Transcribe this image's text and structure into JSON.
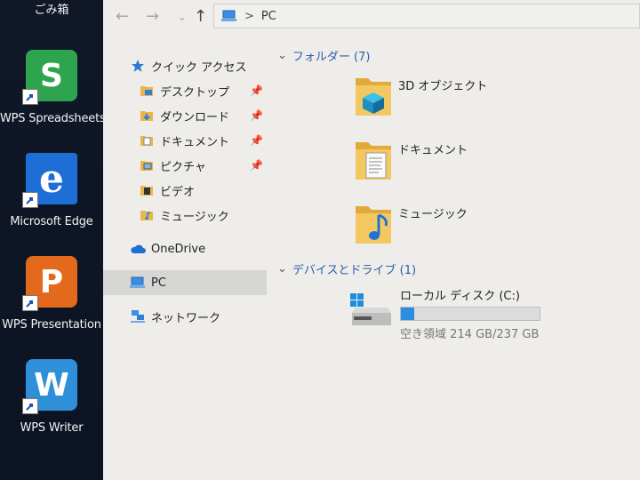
{
  "desktop": {
    "recycle_bin_label": "ごみ箱",
    "icons": [
      {
        "label": "WPS Spreadsheets",
        "glyph": "S",
        "color": "#2ea44f",
        "icon": "wps-spreadsheets-icon"
      },
      {
        "label": "Microsoft Edge",
        "glyph": "e",
        "color": "#1d6fd6",
        "icon": "edge-icon"
      },
      {
        "label": "WPS Presentation",
        "glyph": "P",
        "color": "#e36a1c",
        "icon": "wps-presentation-icon"
      },
      {
        "label": "WPS Writer",
        "glyph": "W",
        "color": "#2f8fd8",
        "icon": "wps-writer-icon"
      }
    ]
  },
  "explorer": {
    "address": {
      "location": "PC"
    },
    "sidebar": {
      "quick_access": "クイック アクセス",
      "items": [
        {
          "label": "デスクトップ",
          "pinned": true
        },
        {
          "label": "ダウンロード",
          "pinned": true
        },
        {
          "label": "ドキュメント",
          "pinned": true
        },
        {
          "label": "ピクチャ",
          "pinned": true
        },
        {
          "label": "ビデオ",
          "pinned": false
        },
        {
          "label": "ミュージック",
          "pinned": false
        }
      ],
      "onedrive": "OneDrive",
      "pc": "PC",
      "network": "ネットワーク"
    },
    "folders_group": {
      "title": "フォルダー (7)",
      "items": [
        {
          "label": "3D オブジェクト"
        },
        {
          "label": "ドキュメント"
        },
        {
          "label": "ミュージック"
        }
      ]
    },
    "drives_group": {
      "title": "デバイスとドライブ (1)",
      "drive": {
        "name": "ローカル ディスク (C:)",
        "free_text": "空き領域 214 GB/237 GB",
        "used_fraction": 0.097
      }
    }
  }
}
